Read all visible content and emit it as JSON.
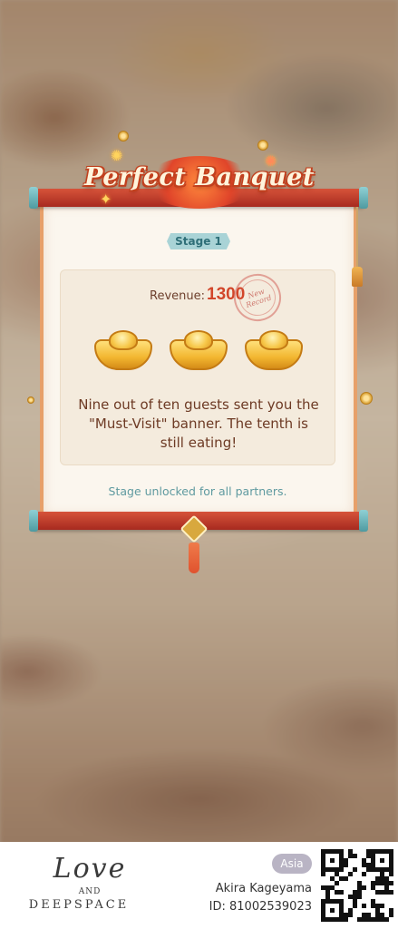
{
  "dialog": {
    "title": "Perfect Banquet",
    "stage_label": "Stage 1",
    "revenue_label": "Revenue:",
    "revenue_value": "1300",
    "stamp_text": "New Record",
    "rewards": [
      "gold-ingot-icon",
      "gold-ingot-icon",
      "gold-ingot-icon"
    ],
    "message": "Nine out of ten guests sent you the \"Must-Visit\" banner. The tenth is still eating!",
    "unlock_note": "Stage unlocked for all partners."
  },
  "footer": {
    "logo_line1": "Love",
    "logo_line2": "AND",
    "logo_line3": "DEEPSPACE",
    "region": "Asia",
    "player_name": "Akira Kageyama",
    "player_id": "ID: 81002539023"
  },
  "colors": {
    "accent_red": "#d2462a",
    "scroll_red": "#c2402a",
    "teal": "#5f9aa0",
    "gold": "#f2b630"
  }
}
